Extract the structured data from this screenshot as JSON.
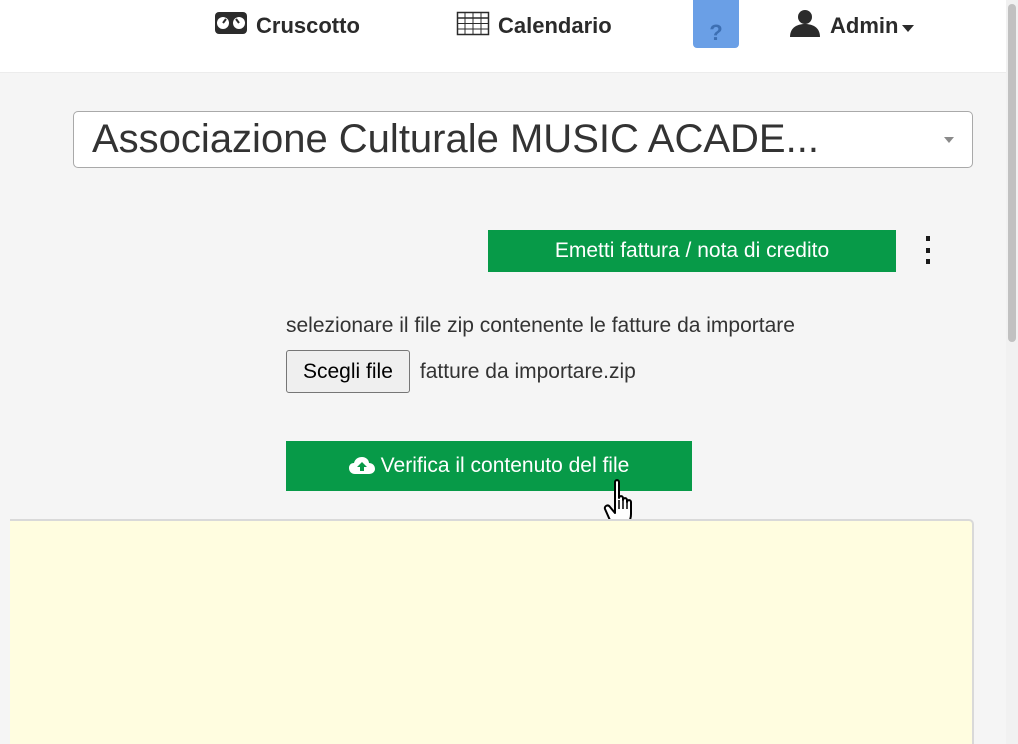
{
  "navbar": {
    "dashboard_label": "Cruscotto",
    "calendar_label": "Calendario",
    "help_label": "?",
    "user_label": "Admin",
    "icons": {
      "dashboard": "dashboard-icon",
      "calendar": "calendar-icon",
      "user": "user-icon",
      "user_menu": "caret-down-icon"
    }
  },
  "organization_select": {
    "value": "Associazione Culturale MUSIC ACADE..."
  },
  "actions": {
    "issue_invoice_label": "Emetti fattura / nota di credito",
    "more_menu_icon": "kebab-menu-icon"
  },
  "import": {
    "instructions": "selezionare il file zip contenente le fatture da importare",
    "choose_file_label": "Scegli file",
    "selected_file": "fatture da importare.zip",
    "verify_button_label": "Verifica il contenuto del file",
    "verify_icon": "cloud-upload-icon"
  },
  "colors": {
    "primary_green": "#079a48",
    "help_blue": "#6a9fe6",
    "panel_yellow": "#fffde0",
    "page_background": "#f5f5f5"
  }
}
